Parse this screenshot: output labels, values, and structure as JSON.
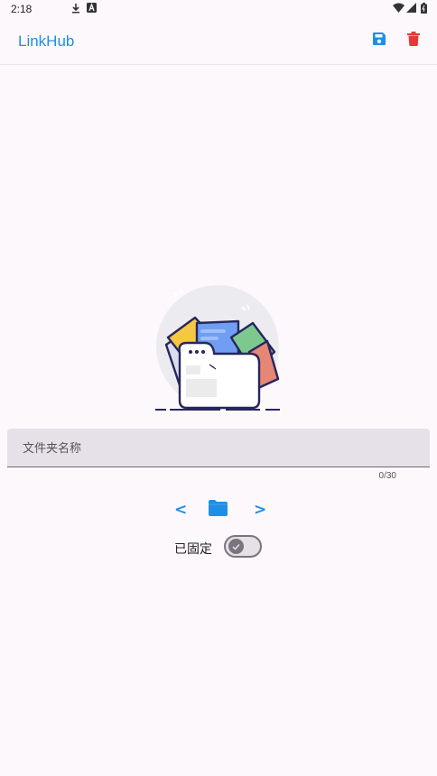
{
  "status_bar": {
    "time": "2:18",
    "icons": [
      "download-icon",
      "a-notification-icon",
      "wifi-icon",
      "signal-icon",
      "battery-icon"
    ]
  },
  "app_bar": {
    "title": "LinkHub",
    "actions": [
      "save-icon",
      "delete-icon"
    ]
  },
  "form": {
    "folder_name_placeholder": "文件夹名称",
    "folder_name_value": "",
    "char_counter": "0/30"
  },
  "navigation": {
    "prev_label": "<",
    "next_label": ">",
    "center_icon": "folder-icon"
  },
  "pinned": {
    "label": "已固定",
    "checked": false
  },
  "colors": {
    "accent": "#1e8fe6",
    "delete": "#e53935",
    "background": "#fdf8fc",
    "field_bg": "#e6e0e9"
  }
}
